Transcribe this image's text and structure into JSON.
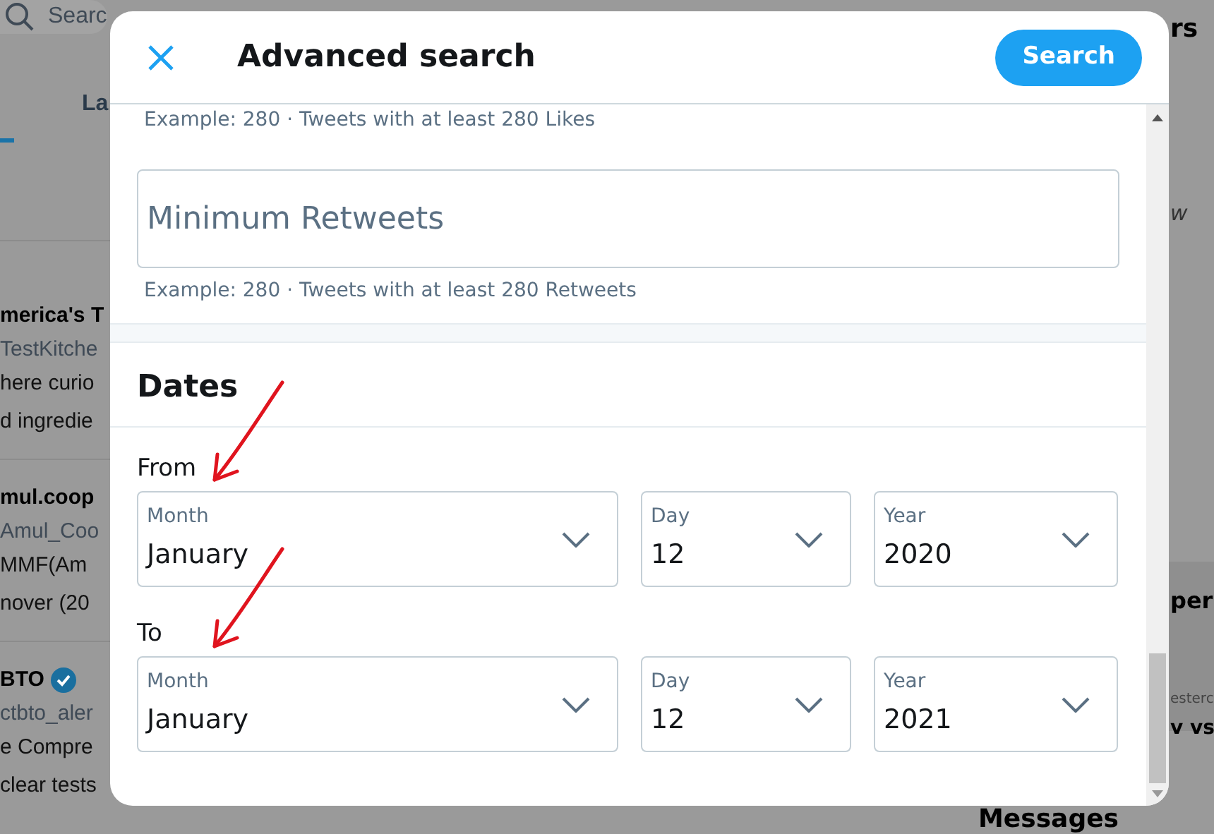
{
  "background": {
    "search_placeholder": "Searc",
    "tab": "La",
    "left_texts": [
      {
        "kind": "name",
        "text": "merica's T"
      },
      {
        "kind": "handle",
        "text": "TestKitche"
      },
      {
        "kind": "body",
        "text": "here curio"
      },
      {
        "kind": "body",
        "text": "d ingredie"
      },
      {
        "kind": "name",
        "text": "mul.coop"
      },
      {
        "kind": "handle",
        "text": "Amul_Coo"
      },
      {
        "kind": "body",
        "text": "MMF(Am"
      },
      {
        "kind": "body",
        "text": "nover (20"
      },
      {
        "kind": "name",
        "text": "BTO",
        "verified": true
      },
      {
        "kind": "handle",
        "text": "ctbto_aler"
      },
      {
        "kind": "body",
        "text": "e Compre"
      },
      {
        "kind": "body",
        "text": "clear tests"
      }
    ],
    "right_texts": [
      {
        "kind": "heading",
        "text": "rs"
      },
      {
        "kind": "body",
        "text": "w"
      },
      {
        "kind": "heading",
        "text": "per"
      },
      {
        "kind": "handle",
        "text": "esterc"
      },
      {
        "kind": "name",
        "text": "v vs"
      },
      {
        "kind": "heading",
        "text": "Messages"
      }
    ]
  },
  "dialog": {
    "title": "Advanced search",
    "action": "Search",
    "likes_hint": "Example: 280 · Tweets with at least 280 Likes",
    "retweets_field": {
      "placeholder": "Minimum Retweets",
      "hint": "Example: 280 · Tweets with at least 280 Retweets"
    },
    "dates": {
      "heading": "Dates",
      "ranges": [
        {
          "label": "From",
          "selects": [
            {
              "label": "Month",
              "value": "January"
            },
            {
              "label": "Day",
              "value": "12"
            },
            {
              "label": "Year",
              "value": "2020"
            }
          ]
        },
        {
          "label": "To",
          "selects": [
            {
              "label": "Month",
              "value": "January"
            },
            {
              "label": "Day",
              "value": "12"
            },
            {
              "label": "Year",
              "value": "2021"
            }
          ]
        }
      ]
    }
  }
}
